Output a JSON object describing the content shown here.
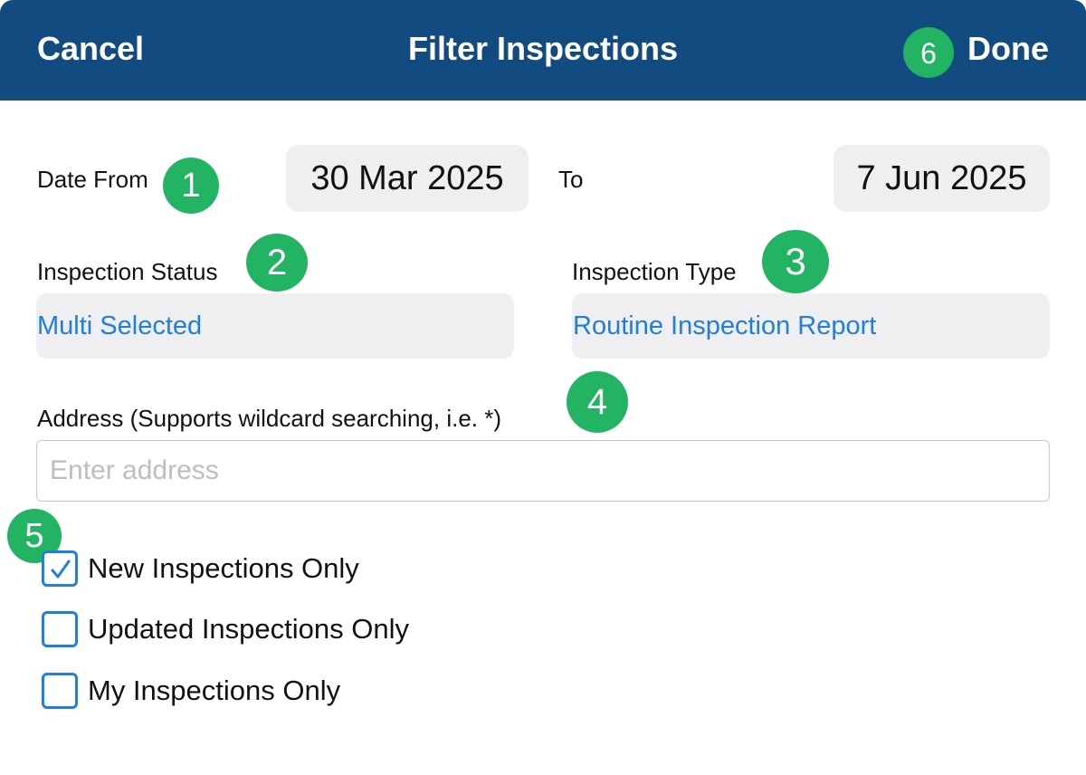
{
  "header": {
    "cancel_label": "Cancel",
    "title": "Filter Inspections",
    "done_label": "Done",
    "done_badge": "6",
    "background_color": "#114b80"
  },
  "date_range": {
    "from_label": "Date From",
    "from_badge": "1",
    "from_value": "30 Mar 2025",
    "to_label": "To",
    "to_value": "7 Jun 2025"
  },
  "inspection_status": {
    "label": "Inspection Status",
    "badge": "2",
    "value": "Multi Selected"
  },
  "inspection_type": {
    "label": "Inspection Type",
    "badge": "3",
    "value": "Routine Inspection Report"
  },
  "address": {
    "label": "Address (Supports wildcard searching, i.e. *)",
    "badge": "4",
    "value": "",
    "placeholder": "Enter address"
  },
  "options": {
    "badge": "5",
    "items": [
      {
        "label": "New Inspections Only",
        "checked": true
      },
      {
        "label": "Updated Inspections Only",
        "checked": false
      },
      {
        "label": "My Inspections Only",
        "checked": false
      }
    ]
  },
  "colors": {
    "accent": "#1f7ee0",
    "badge": "#22b463",
    "field_bg": "#efeff2"
  },
  "icons": {
    "checkmark": "check-icon"
  }
}
